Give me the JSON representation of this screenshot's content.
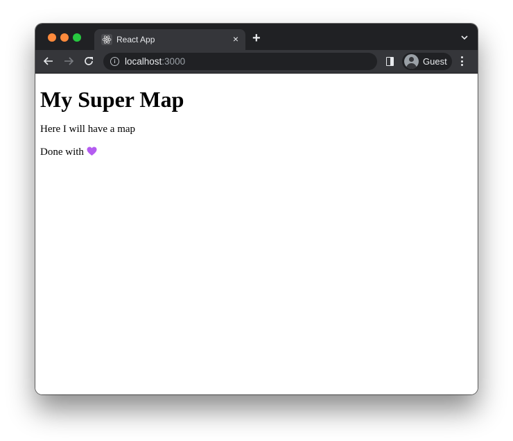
{
  "browser": {
    "tab": {
      "title": "React App",
      "favicon": "react-atom-icon",
      "close_glyph": "×"
    },
    "new_tab_glyph": "+",
    "address": {
      "host": "localhost",
      "port": ":3000",
      "security_icon": "info-icon"
    },
    "profile": {
      "name": "Guest"
    },
    "colors": {
      "tabbar": "#202124",
      "toolbar": "#35363a",
      "traffic_close": "#fe8a3c",
      "traffic_min": "#fd8a3c",
      "traffic_max": "#27c840"
    }
  },
  "page": {
    "heading": "My Super Map",
    "paragraphs": [
      "Here I will have a map",
      "Done with"
    ],
    "emoji": {
      "name": "purple-heart",
      "color": "#b45cf0"
    }
  }
}
